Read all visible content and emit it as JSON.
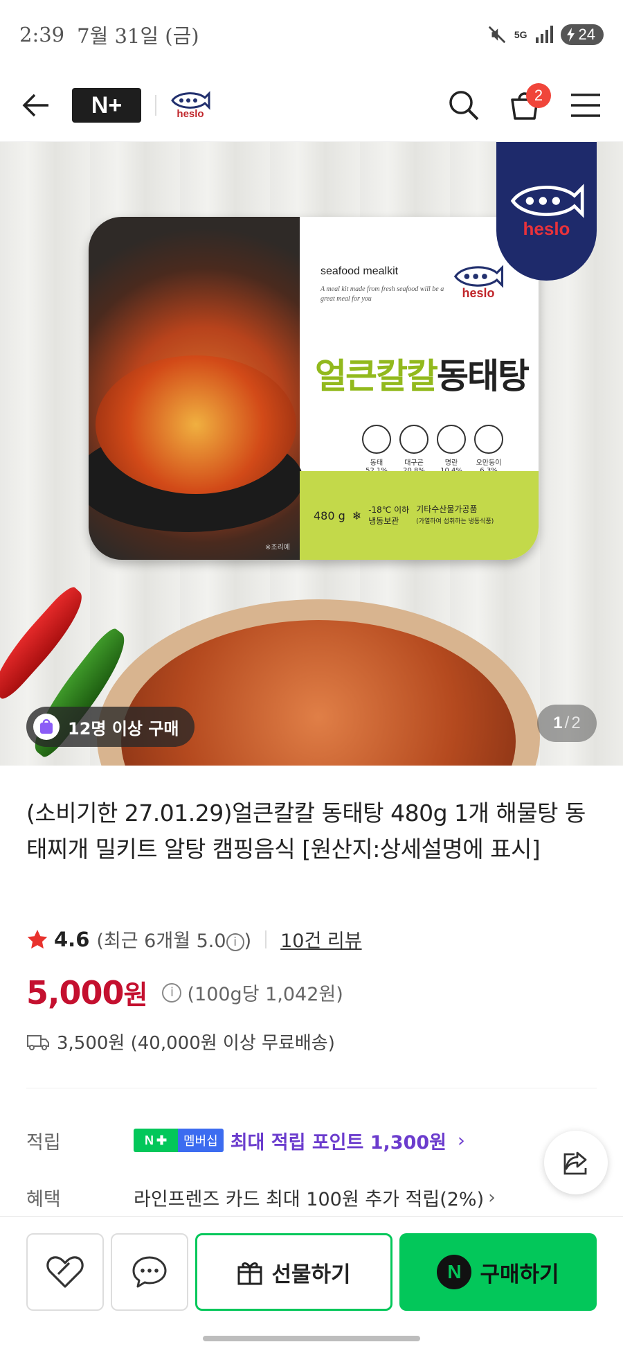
{
  "status_bar": {
    "time": "2:39",
    "date": "7월 31일 (금)",
    "network": "5G",
    "battery": "24"
  },
  "header": {
    "back_icon": "arrow-left-icon",
    "logo_text": "N+",
    "brand": "heslo",
    "cart_count": "2"
  },
  "hero": {
    "package": {
      "eng_title": "seafood mealkit",
      "eng_sub": "A meal kit made from fresh seafood will be a great meal for you",
      "brand": "heslo",
      "name_green": "얼큰칼칼",
      "name_dark": "동태탕",
      "ingredients": [
        {
          "name": "동태",
          "pct": "52.1%"
        },
        {
          "name": "대구곤",
          "pct": "20.8%"
        },
        {
          "name": "명란",
          "pct": "10.4%"
        },
        {
          "name": "오만둥이",
          "pct": "6.3%"
        }
      ],
      "weight": "480 g",
      "storage_line1": "-18℃ 이하",
      "storage_line2": "냉동보관",
      "type_line1": "기타수산물가공품",
      "type_line2": "(가열하여 섭취하는 냉동식품)",
      "note": "※조리예"
    },
    "flag_brand": "heslo",
    "buy_count": "12명 이상 구매",
    "page_current": "1",
    "page_sep": "/",
    "page_total": "2"
  },
  "product": {
    "title": "(소비기한 27.01.29)얼큰칼칼 동태탕 480g 1개 해물탕 동태찌개 밀키트 알탕 캠핑음식 [원산지:상세설명에 표시]",
    "rating": "4.6",
    "recent_rating_prefix": "(최근 6개월 5.0",
    "recent_rating_suffix": ")",
    "info_glyph": "i",
    "review_link": "10건 리뷰",
    "price": "5,000",
    "price_unit": "원",
    "unit_price": "(100g당 1,042원)",
    "shipping": "3,500원 (40,000원 이상 무료배송)"
  },
  "info": {
    "points_label": "적립",
    "badge_text": "멤버십",
    "points_text": "최대 적립 포인트 1,300원",
    "benefit_label": "혜택",
    "benefit_text": "라인프렌즈 카드 최대 100원 추가 적립(2%)",
    "chevron": "›"
  },
  "bottom_bar": {
    "gift_label": "선물하기",
    "buy_label": "구매하기",
    "buy_logo": "N"
  },
  "colors": {
    "price_red": "#c4102f",
    "naver_green": "#03c75a",
    "points_purple": "#6b3ccd",
    "badge_red": "#f0453a"
  }
}
